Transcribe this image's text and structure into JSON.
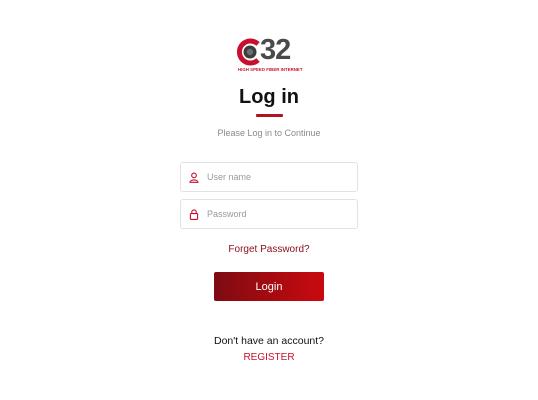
{
  "brand": {
    "number": "32",
    "tagline": "HIGH SPEED FIBER INTERNET"
  },
  "login": {
    "title": "Log in",
    "subtitle": "Please Log in to Continue",
    "username": {
      "placeholder": "User name",
      "value": "",
      "icon": "user-icon"
    },
    "password": {
      "placeholder": "Password",
      "value": "",
      "icon": "lock-icon"
    },
    "forgot_label": "Forget Password?",
    "button_label": "Login",
    "no_account_text": "Don't have an account?",
    "register_label": "REGISTER"
  },
  "colors": {
    "accent": "#c8102e",
    "dark_accent": "#8b0e1a",
    "button_gradient_start": "#7e0b12",
    "button_gradient_end": "#c90a0f",
    "logo_gray": "#4a4a4a"
  }
}
